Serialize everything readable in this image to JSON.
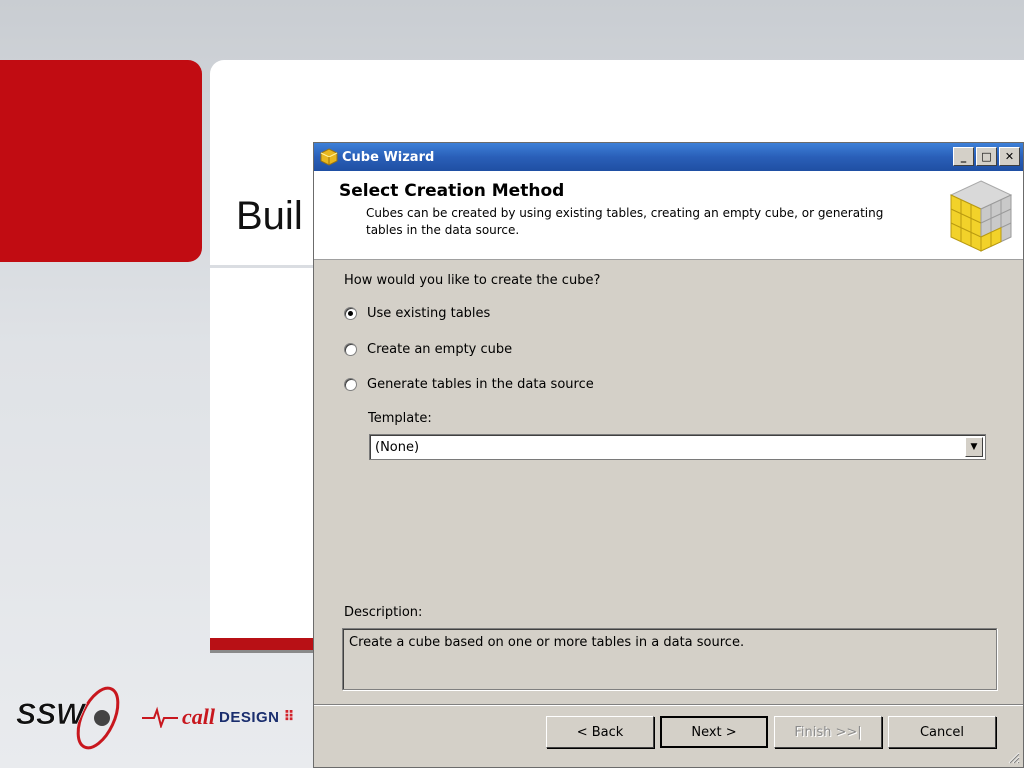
{
  "slide": {
    "title_fragment": "Buil",
    "logos": {
      "ssw": "SSW",
      "call": "call",
      "design": "DESIGN"
    }
  },
  "dialog": {
    "title": "Cube Wizard",
    "window_buttons": {
      "minimize": "_",
      "maximize": "□",
      "close": "✕"
    },
    "header": {
      "title": "Select Creation Method",
      "description": "Cubes can be created by using existing tables, creating an empty cube, or generating tables in the data source."
    },
    "question": "How would you like to create the cube?",
    "options": [
      {
        "label": "Use existing tables",
        "selected": true
      },
      {
        "label": "Create an empty cube",
        "selected": false
      },
      {
        "label": "Generate tables in the data source",
        "selected": false
      }
    ],
    "template": {
      "label": "Template:",
      "value": "(None)"
    },
    "description": {
      "label": "Description:",
      "text": "Create a cube based on one or more tables in a data source."
    },
    "buttons": {
      "back": "< Back",
      "next": "Next >",
      "finish": "Finish >>|",
      "cancel": "Cancel"
    }
  },
  "colors": {
    "slide_red": "#c10c12",
    "titlebar_blue": "#2a5fb8",
    "dialog_face": "#d4d0c8"
  }
}
